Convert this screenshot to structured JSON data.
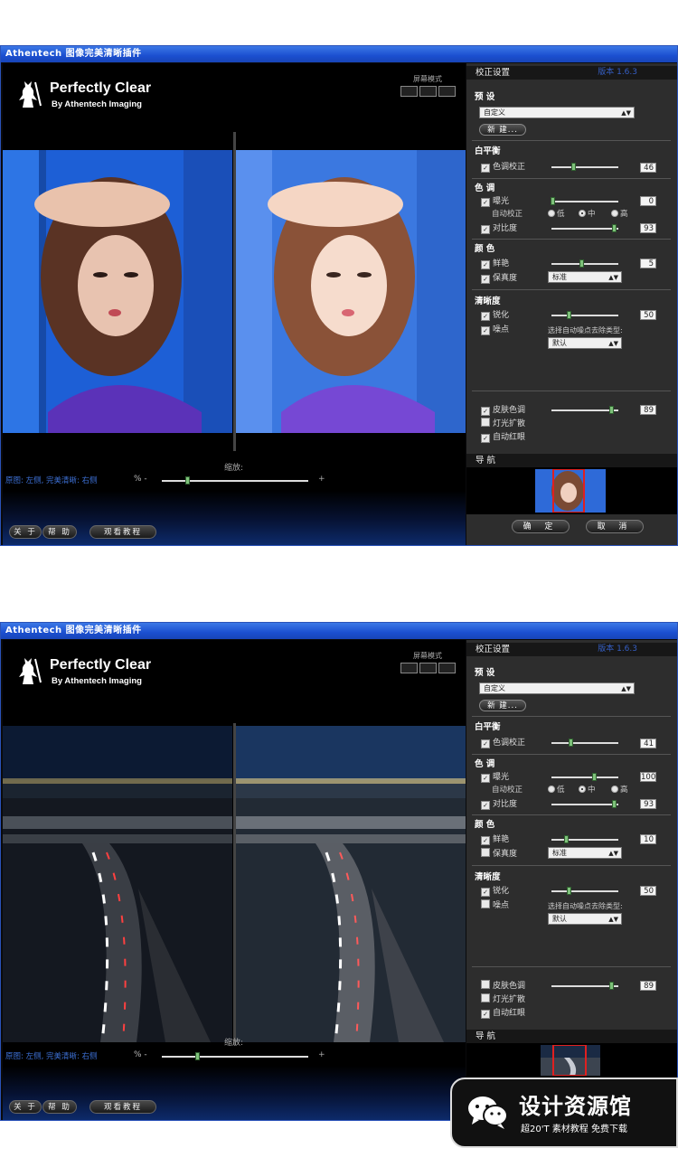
{
  "app": {
    "title": "Athentech 图像完美清晰插件",
    "logo_title": "Perfectly Clear",
    "logo_sub": "By Athentech Imaging",
    "screen_mode": "屏幕模式",
    "version": "版本 1.6.3"
  },
  "left": {
    "zoom_label": "缩放:",
    "compare_note": "原图: 左侧, 完美清晰: 右侧",
    "pct_minus": "% -",
    "plus": "+",
    "about": "关 于",
    "help": "帮 助",
    "tutorial": "观看教程"
  },
  "right": {
    "panel_title": "校正设置",
    "preset": "预 设",
    "preset_value": "自定义",
    "new_btn": "新 建...",
    "wb": "白平衡",
    "tint": "色调校正",
    "tone": "色 调",
    "exposure": "曝光",
    "auto_correct": "自动校正",
    "low": "低",
    "mid": "中",
    "high": "高",
    "contrast": "对比度",
    "color": "颜 色",
    "vivid": "鲜艳",
    "fidelity": "保真度",
    "fidelity_value": "标准",
    "sharp": "清晰度",
    "sharpen": "锐化",
    "noise": "噪点",
    "noise_type": "选择自动噪点去除类型:",
    "noise_value": "默认",
    "skin": "皮肤色调",
    "light": "灯光扩散",
    "redeye": "自动红眼",
    "nav": "导 航",
    "ok": "确 定",
    "cancel": "取 消"
  },
  "screens": [
    {
      "values": {
        "tint": "46",
        "exposure": "0",
        "contrast": "93",
        "vivid": "5",
        "sharpen": "50",
        "skin": "89"
      },
      "levels": {
        "zoom": 0.17,
        "tint": 0.33,
        "exposure": 0.02,
        "contrast": 0.93,
        "vivid": 0.45,
        "sharpen": 0.25,
        "skin": 0.89
      },
      "checks": {
        "tint": true,
        "exposure": true,
        "contrast": true,
        "vivid": true,
        "fidelity": true,
        "sharpen": true,
        "noise": true,
        "skin": true,
        "light": false,
        "redeye": true
      }
    },
    {
      "values": {
        "tint": "41",
        "exposure": "100",
        "contrast": "93",
        "vivid": "10",
        "sharpen": "50",
        "skin": "89"
      },
      "levels": {
        "zoom": 0.24,
        "tint": 0.29,
        "exposure": 0.64,
        "contrast": 0.93,
        "vivid": 0.22,
        "sharpen": 0.25,
        "skin": 0.89
      },
      "checks": {
        "tint": true,
        "exposure": true,
        "contrast": true,
        "vivid": true,
        "fidelity": false,
        "sharpen": true,
        "noise": false,
        "skin": false,
        "light": false,
        "redeye": true
      }
    }
  ],
  "watermark": {
    "title": "设计资源馆",
    "subtitle": "超20'T 素材教程 免费下载"
  }
}
